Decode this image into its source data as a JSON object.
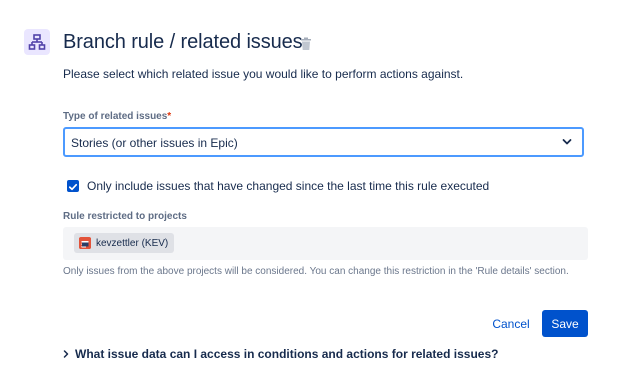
{
  "header": {
    "icon": "branch-icon",
    "title": "Branch rule / related issues",
    "delete_icon": "trash-icon"
  },
  "subtitle": "Please select which related issue you would like to perform actions against.",
  "related_type": {
    "label": "Type of related issues",
    "required_mark": "*",
    "selected_value": "Stories (or other issues in Epic)"
  },
  "only_changed": {
    "checked": true,
    "label": "Only include issues that have changed since the last time this rule executed"
  },
  "projects": {
    "label": "Rule restricted to projects",
    "items": [
      {
        "name": "kevzettler (KEV)",
        "icon": "project-icon"
      }
    ],
    "help": "Only issues from the above projects will be considered. You can change this restriction in the 'Rule details' section."
  },
  "actions": {
    "cancel_label": "Cancel",
    "save_label": "Save"
  },
  "faq": {
    "label": "What issue data can I access in conditions and actions for related issues?"
  },
  "colors": {
    "primary": "#0052CC",
    "focus_border": "#4C9AFF",
    "icon_bg": "#EAE6FF",
    "icon_fg": "#5243AA",
    "required": "#DE350B"
  }
}
